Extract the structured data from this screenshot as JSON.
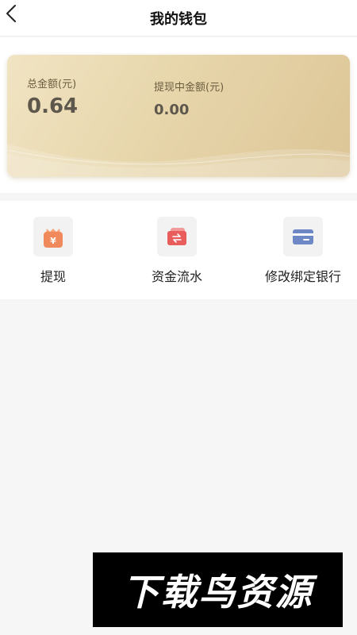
{
  "header": {
    "title": "我的钱包"
  },
  "wallet": {
    "total_label": "总金额(元)",
    "total_value": "0.64",
    "pending_label": "提现中金额(元)",
    "pending_value": "0.00"
  },
  "actions": [
    {
      "label": "提现",
      "icon": "wallet-yuan-icon",
      "color": "#f08a5d"
    },
    {
      "label": "资金流水",
      "icon": "transfer-icon",
      "color": "#e85c5c"
    },
    {
      "label": "修改绑定银行",
      "icon": "bank-card-icon",
      "color": "#6e88c6"
    }
  ],
  "watermark": {
    "text": "下载鸟资源"
  },
  "colors": {
    "card_gold": "#e7d6ab",
    "background": "#f6f6f6"
  }
}
